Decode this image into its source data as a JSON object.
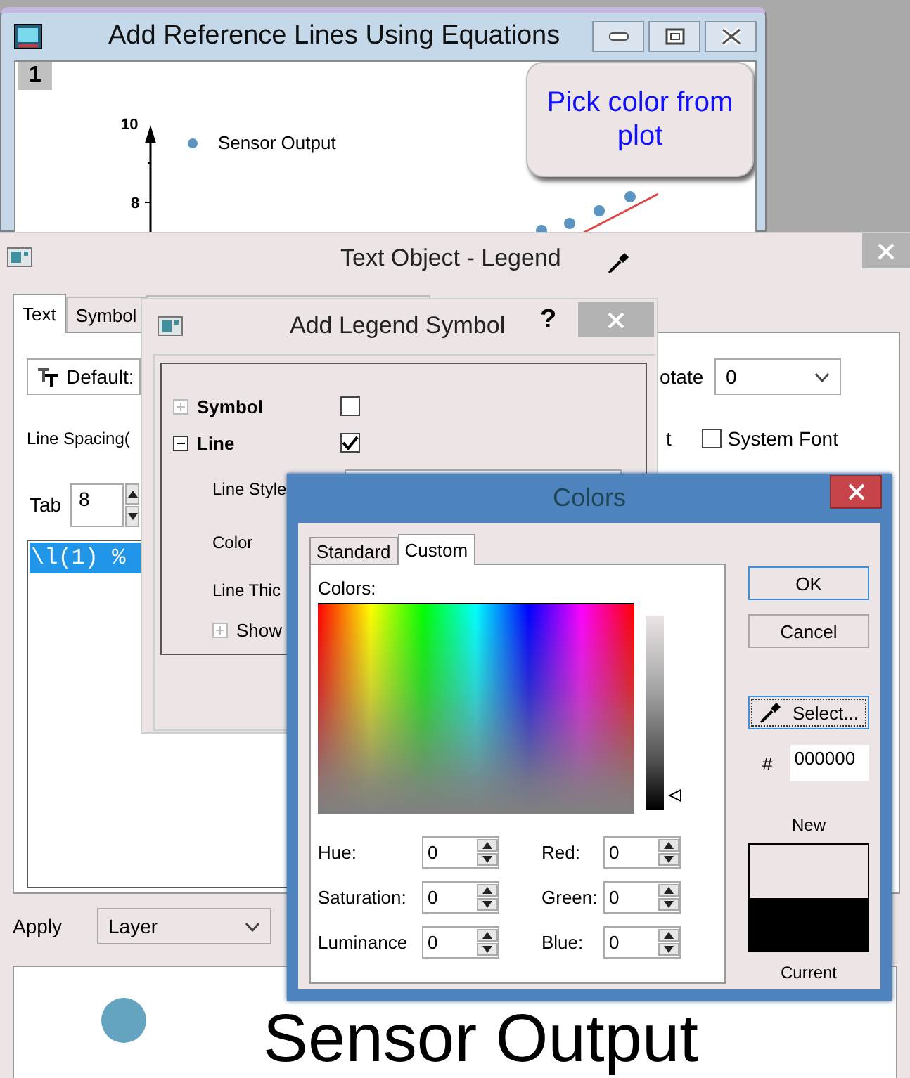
{
  "graph_window": {
    "title": "Add Reference Lines Using Equations",
    "page": "1",
    "y_ticks": [
      "10",
      "8"
    ],
    "legend": "Sensor Output",
    "callout": "Pick color from plot"
  },
  "text_object_dialog": {
    "title": "Text Object - Legend",
    "tabs": [
      {
        "label": "Text",
        "selected": true
      },
      {
        "label": "Symbol",
        "selected": false
      }
    ],
    "font": "Default:",
    "rotate_label": "otate",
    "rotate_value": "0",
    "line_spacing_label": "Line Spacing(",
    "cut_label": "t",
    "system_font": {
      "label": "System Font",
      "checked": false
    },
    "tab_label": "Tab",
    "tab_value": "8",
    "editor_lines": [
      {
        "text": "\\l(1) %",
        "selected": true
      }
    ],
    "apply_label": "Apply",
    "apply_value": "Layer",
    "preview_text": "Sensor Output"
  },
  "legend_symbol_dialog": {
    "title": "Add Legend Symbol",
    "help": "?",
    "rows": [
      {
        "kind": "check",
        "label": "Symbol",
        "expanded": false,
        "checked": false
      },
      {
        "kind": "check",
        "label": "Line",
        "expanded": true,
        "checked": true
      },
      {
        "kind": "dropdown",
        "label": "Line Style"
      },
      {
        "kind": "label",
        "label": "Color"
      },
      {
        "kind": "label",
        "label": "Line Thic"
      },
      {
        "kind": "expander",
        "label": "Show",
        "expanded": false
      }
    ]
  },
  "colors_dialog": {
    "title": "Colors",
    "tabs": [
      {
        "label": "Standard",
        "selected": false
      },
      {
        "label": "Custom",
        "selected": true
      }
    ],
    "colors_label": "Colors:",
    "fields": [
      {
        "label": "Hue:",
        "value": "0"
      },
      {
        "label": "Red:",
        "value": "0"
      },
      {
        "label": "Saturation:",
        "value": "0"
      },
      {
        "label": "Green:",
        "value": "0"
      },
      {
        "label": "Luminance",
        "value": "0"
      },
      {
        "label": "Blue:",
        "value": "0"
      }
    ],
    "buttons": [
      {
        "label": "OK",
        "default": true
      },
      {
        "label": "Cancel",
        "default": false
      }
    ],
    "select_button": "Select...",
    "hex_label": "#",
    "hex_value": "000000",
    "new_label": "New",
    "current_label": "Current"
  }
}
